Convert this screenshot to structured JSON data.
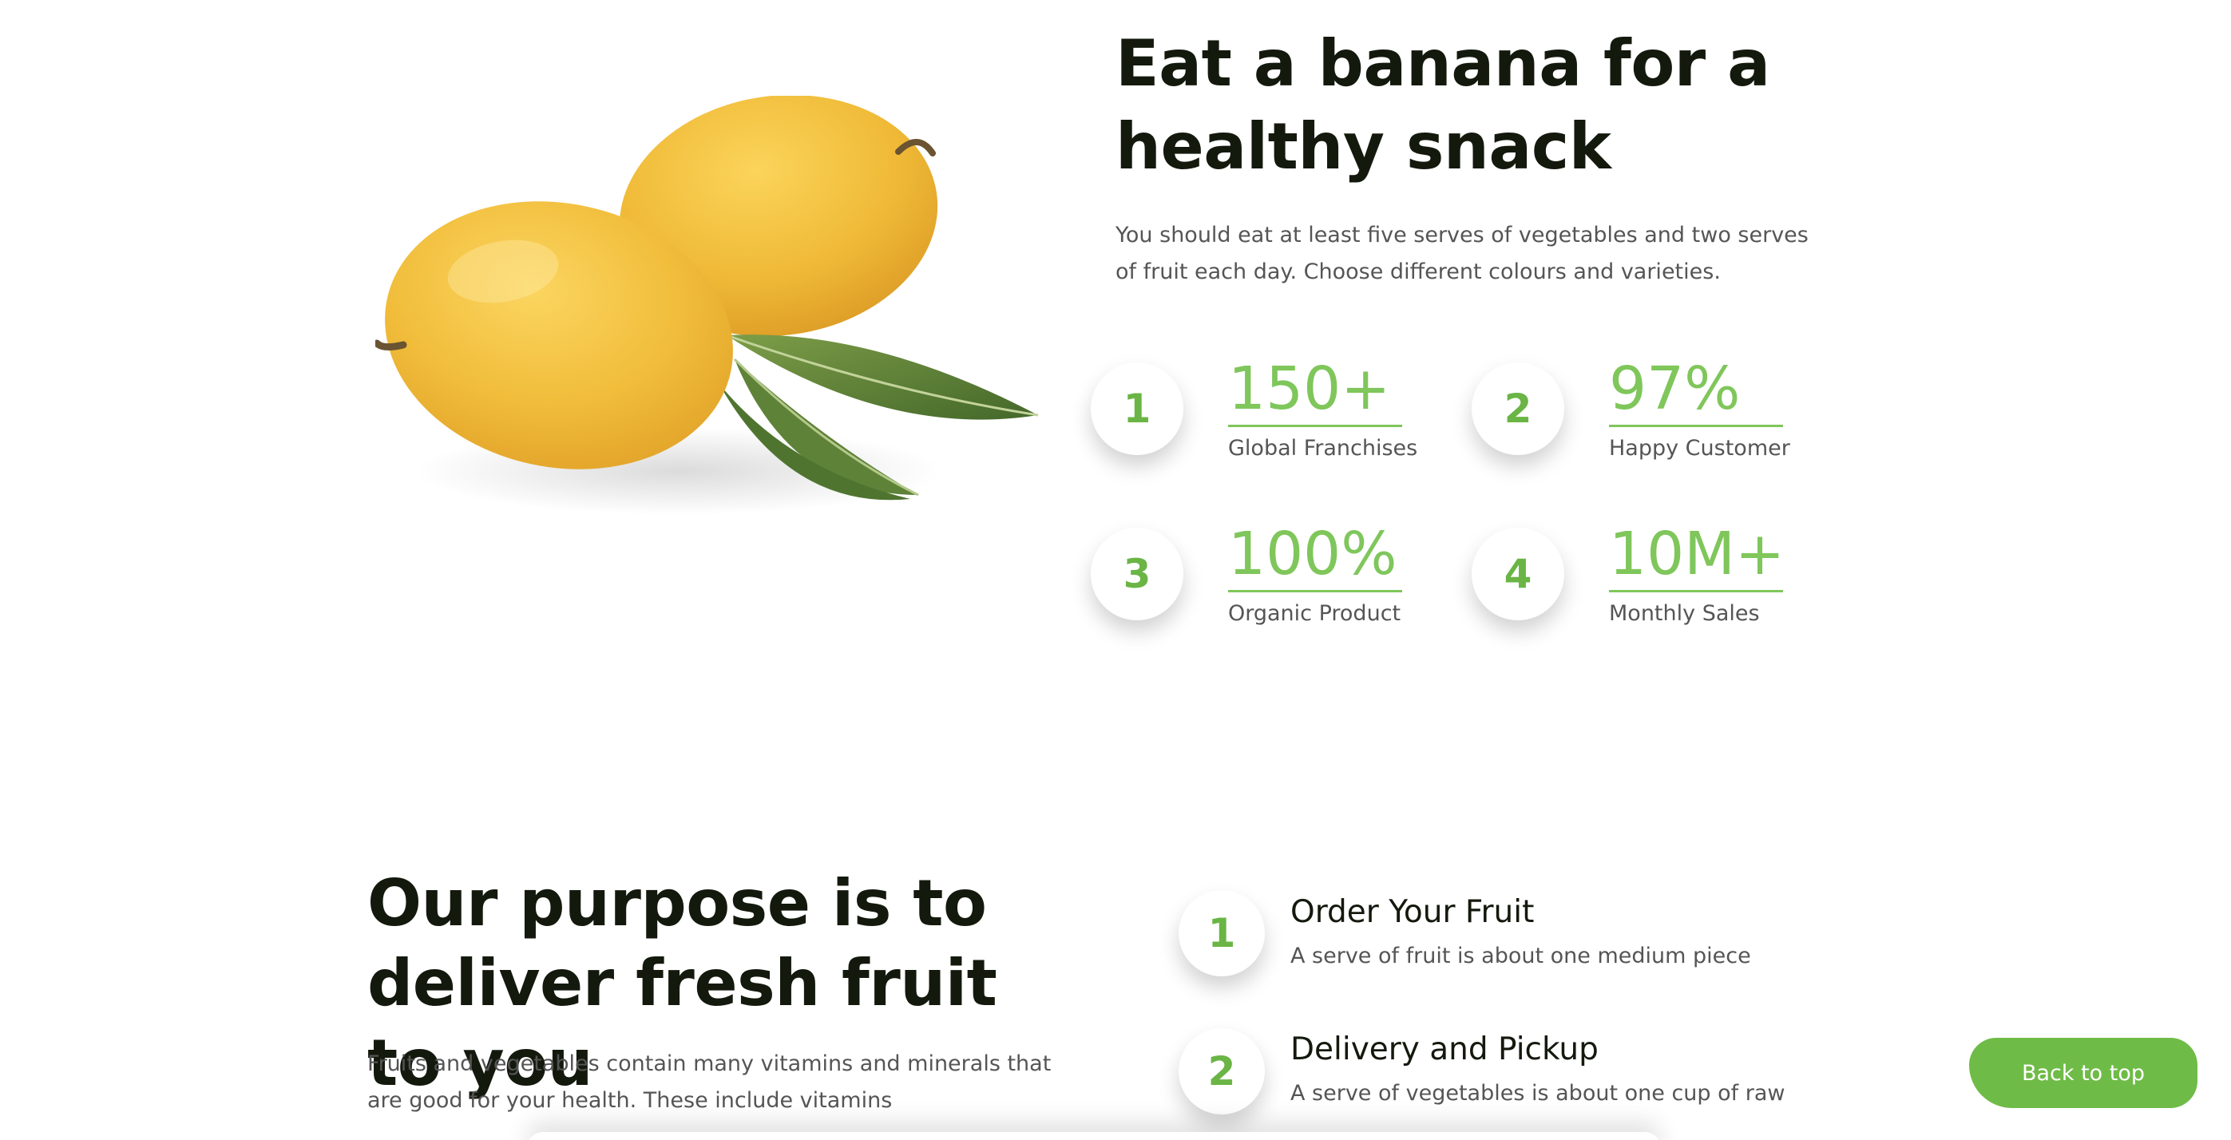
{
  "colors": {
    "accent": "#7fc65b",
    "accent_dark": "#6ab545",
    "button": "#6fbb47",
    "heading": "#14190d",
    "body_text": "#555555"
  },
  "hero": {
    "image_icon": "mango-illustration",
    "headline": "Eat a banana for a healthy snack",
    "description": "You should eat at least five serves of vegetables and two serves of fruit each day. Choose different colours and varieties."
  },
  "stats": [
    {
      "index": "1",
      "value": "150+",
      "label": "Global Franchises"
    },
    {
      "index": "2",
      "value": "97%",
      "label": "Happy Customer"
    },
    {
      "index": "3",
      "value": "100%",
      "label": "Organic Product"
    },
    {
      "index": "4",
      "value": "10M+",
      "label": "Monthly Sales"
    }
  ],
  "purpose": {
    "headline": "Our purpose is to deliver fresh fruit to you",
    "description": "Fruits and vegetables contain many vitamins and minerals that are good for your health. These include vitamins"
  },
  "steps": [
    {
      "index": "1",
      "title": "Order Your Fruit",
      "description": "A serve of fruit is about one medium piece"
    },
    {
      "index": "2",
      "title": "Delivery and Pickup",
      "description": "A serve of vegetables is about one cup of raw"
    }
  ],
  "back_to_top": {
    "label": "Back to top"
  }
}
